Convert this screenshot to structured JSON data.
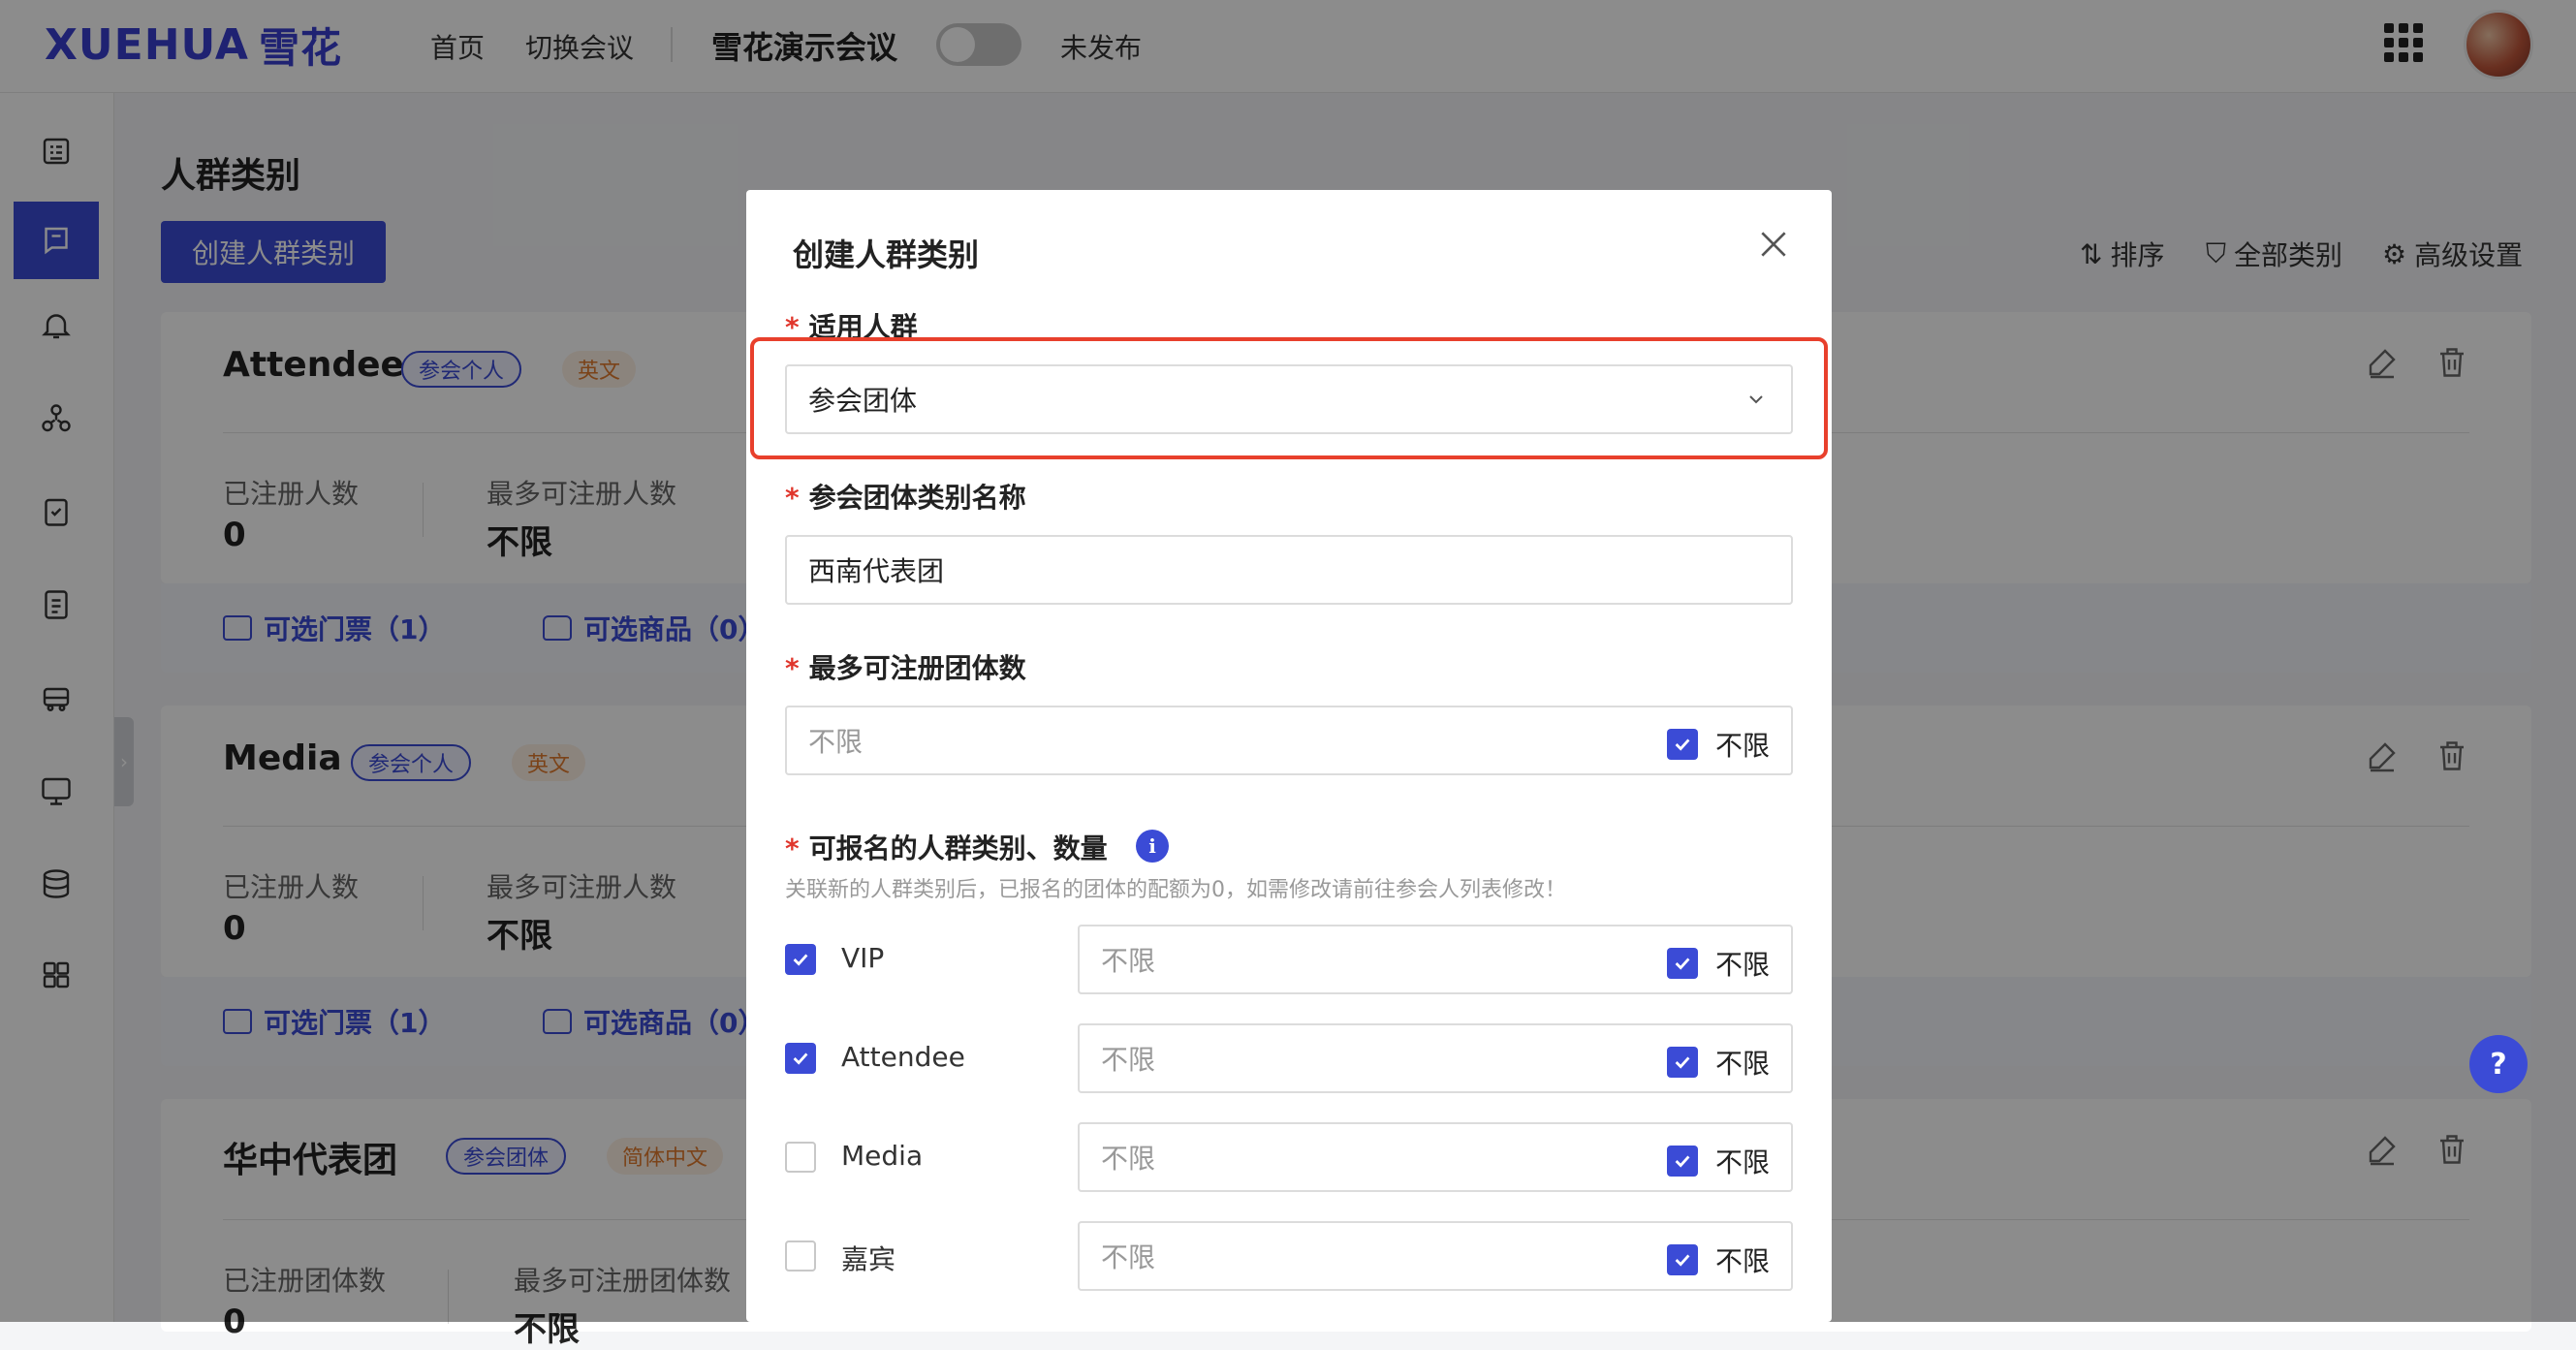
{
  "header": {
    "logo_text": "XUEHUA",
    "logo_cn": "雪花",
    "nav": [
      "首页",
      "切换会议"
    ],
    "conference_name": "雪花演示会议",
    "publish_status": "未发布",
    "apps_icon": "grid-icon"
  },
  "page": {
    "title": "人群类别",
    "create_button": "创建人群类别",
    "tools": {
      "sort": "排序",
      "filter": "全部类别",
      "settings": "高级设置"
    }
  },
  "cards": [
    {
      "name": "Attendee",
      "tag_type": "参会个人",
      "tag_lang": "英文",
      "registered_label": "已注册人数",
      "registered_value": "0",
      "max_label": "最多可注册人数",
      "max_value": "不限",
      "tickets": "可选门票（1）",
      "goods": "可选商品（0）"
    },
    {
      "name": "Media",
      "tag_type": "参会个人",
      "tag_lang": "英文",
      "registered_label": "已注册人数",
      "registered_value": "0",
      "max_label": "最多可注册人数",
      "max_value": "不限",
      "tickets": "可选门票（1）",
      "goods": "可选商品（0）"
    },
    {
      "name": "华中代表团",
      "tag_type": "参会团体",
      "tag_lang": "简体中文",
      "registered_label": "已注册团体数",
      "registered_value": "0",
      "max_label": "最多可注册团体数",
      "max_value": "不限"
    }
  ],
  "modal": {
    "title": "创建人群类别",
    "audience_label": "适用人群",
    "audience_value": "参会团体",
    "name_label": "参会团体类别名称",
    "name_value": "西南代表团",
    "max_label": "最多可注册团体数",
    "max_placeholder": "不限",
    "max_unlimited": "不限",
    "categories_label": "可报名的人群类别、数量",
    "categories_hint": "关联新的人群类别后，已报名的团体的配额为0，如需修改请前往参会人列表修改！",
    "info_glyph": "i",
    "rows": [
      {
        "name": "VIP",
        "checked": true,
        "placeholder": "不限",
        "unlimited": "不限"
      },
      {
        "name": "Attendee",
        "checked": true,
        "placeholder": "不限",
        "unlimited": "不限"
      },
      {
        "name": "Media",
        "checked": false,
        "placeholder": "不限",
        "unlimited": "不限"
      },
      {
        "name": "嘉宾",
        "checked": false,
        "placeholder": "不限",
        "unlimited": "不限"
      }
    ]
  },
  "help_label": "?",
  "colors": {
    "primary": "#3b4bd6",
    "required": "#e0362c",
    "highlight": "#e8402c",
    "tag_orange": "#e07a2e"
  }
}
